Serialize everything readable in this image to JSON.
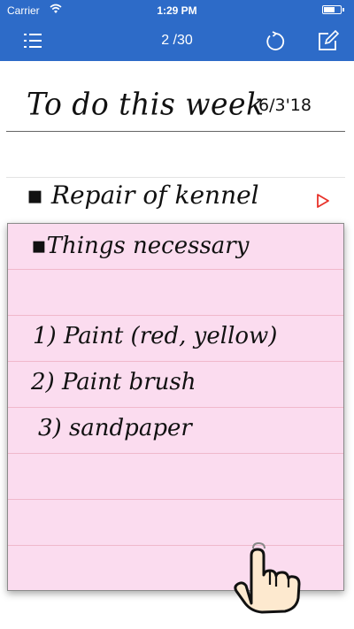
{
  "status_bar": {
    "carrier": "Carrier",
    "time": "1:29 PM"
  },
  "nav": {
    "page_counter": "2 /30",
    "menu_icon": "list-icon",
    "refresh_icon": "refresh-icon",
    "edit_icon": "compose-icon"
  },
  "note": {
    "title": "To do this week",
    "date": "6/3'18",
    "entries": [
      {
        "label": "▪ Repair of kennel",
        "expand_icon": "triangle-right-icon"
      }
    ]
  },
  "subnote": {
    "lines": [
      "▪Things necessary",
      "",
      "1) Paint (red, yellow)",
      "2) Paint brush",
      " 3) sandpaper"
    ]
  },
  "colors": {
    "nav_bar": "#2d6bc8",
    "subnote_background": "#fbdcef",
    "subnote_rule": "#f0b8cb",
    "accent_arrow": "#e8322a"
  }
}
